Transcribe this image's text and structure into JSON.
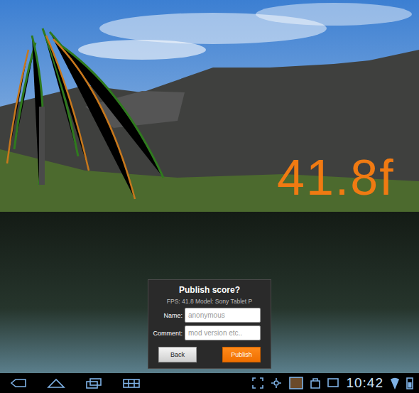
{
  "hud": {
    "fps": "41.8f"
  },
  "dialog": {
    "title": "Publish score?",
    "info": "FPS: 41.8 Model: Sony Tablet P",
    "fields": [
      {
        "label": "Name:",
        "placeholder": "anonymous"
      },
      {
        "label": "Comment:",
        "placeholder": "mod version etc.."
      }
    ],
    "buttons": [
      {
        "label": "Back",
        "kind": "secondary"
      },
      {
        "label": "Publish",
        "kind": "primary"
      }
    ]
  },
  "status_bar": {
    "time": "10:42"
  }
}
